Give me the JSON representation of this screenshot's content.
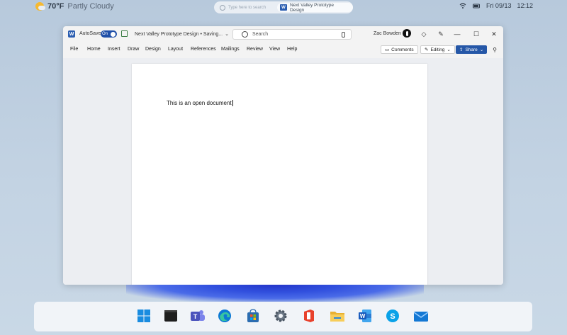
{
  "status_bar": {
    "weather_temp": "70°F",
    "weather_condition": "Partly Cloudy",
    "search_placeholder": "Type here to search",
    "search_doc": "Next Valley Prototype Design",
    "date": "Fri 09/13",
    "time": "12:12"
  },
  "window": {
    "app_icon": "W",
    "autosave_label": "AutoSave",
    "autosave_state": "On",
    "doc_title": "Next Valley Prototype Design • Saving...",
    "search_placeholder": "Search",
    "user_name": "Zac Bowden"
  },
  "menu": {
    "items": [
      "File",
      "Home",
      "Insert",
      "Draw",
      "Design",
      "Layout",
      "References",
      "Mailings",
      "Review",
      "View",
      "Help"
    ],
    "comments_label": "Comments",
    "editing_label": "Editing",
    "share_label": "Share"
  },
  "document": {
    "body_text": "This is an open document"
  },
  "taskbar": {
    "icons": [
      "start-icon",
      "terminal-icon",
      "teams-icon",
      "edge-icon",
      "store-icon",
      "settings-icon",
      "office-icon",
      "file-explorer-icon",
      "word-icon",
      "skype-icon",
      "mail-icon"
    ]
  },
  "colors": {
    "word_blue": "#2a5db0",
    "share_blue": "#2557a7",
    "toggle_blue": "#1f4fa8",
    "desktop_bg": "#c3d3e3"
  }
}
